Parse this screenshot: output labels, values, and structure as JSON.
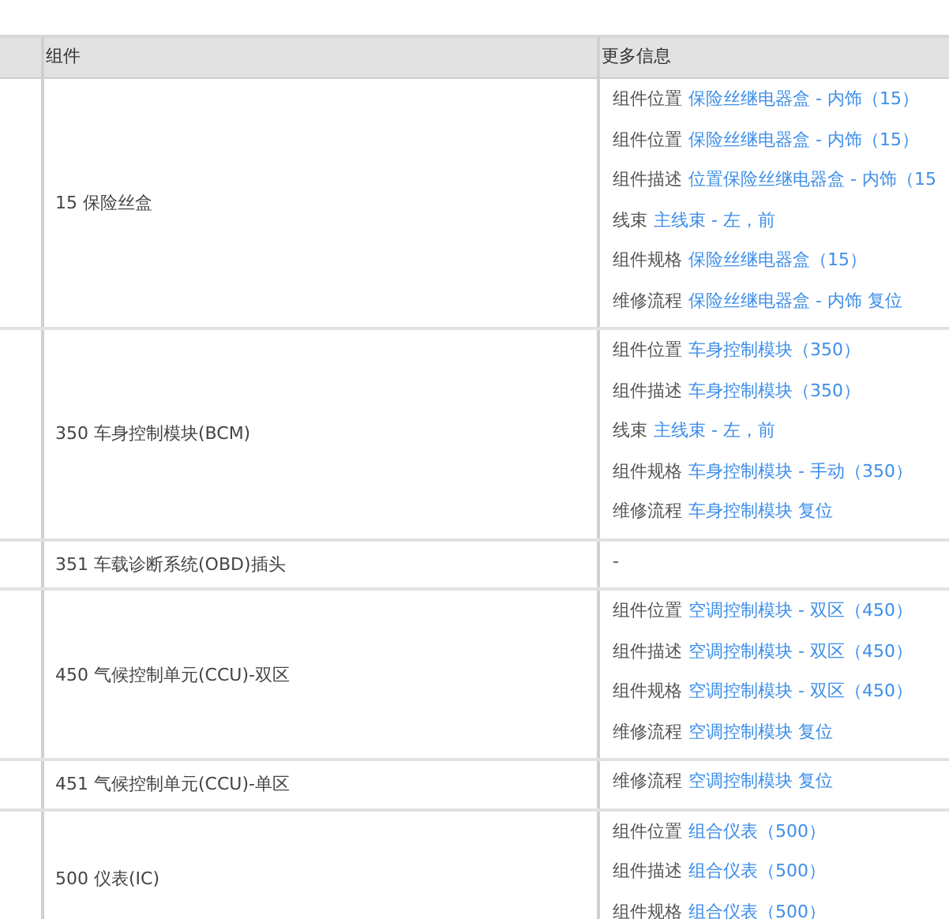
{
  "table": {
    "columns": [
      "组件",
      "更多信息"
    ],
    "rows": [
      {
        "component": "15 保险丝盒",
        "info": [
          {
            "label": "组件位置",
            "link": "保险丝继电器盒 - 内饰（15）"
          },
          {
            "label": "组件位置",
            "link": "保险丝继电器盒 - 内饰（15）"
          },
          {
            "label": "组件描述",
            "link": "位置保险丝继电器盒 - 内饰（15"
          },
          {
            "label": "线束",
            "link": "主线束 - 左，前"
          },
          {
            "label": "组件规格",
            "link": "保险丝继电器盒（15）"
          },
          {
            "label": "维修流程",
            "link": "保险丝继电器盒 - 内饰 复位"
          }
        ]
      },
      {
        "component": "350 车身控制模块(BCM)",
        "info": [
          {
            "label": "组件位置",
            "link": "车身控制模块（350）"
          },
          {
            "label": "组件描述",
            "link": "车身控制模块（350）"
          },
          {
            "label": "线束",
            "link": "主线束 - 左，前"
          },
          {
            "label": "组件规格",
            "link": "车身控制模块 - 手动（350）"
          },
          {
            "label": "维修流程",
            "link": "车身控制模块 复位"
          }
        ]
      },
      {
        "component": "351 车载诊断系统(OBD)插头",
        "info": [
          {
            "label": "-"
          }
        ]
      },
      {
        "component": "450 气候控制单元(CCU)-双区",
        "info": [
          {
            "label": "组件位置",
            "link": "空调控制模块 - 双区（450）"
          },
          {
            "label": "组件描述",
            "link": "空调控制模块 - 双区（450）"
          },
          {
            "label": "组件规格",
            "link": "空调控制模块 - 双区（450）"
          },
          {
            "label": "维修流程",
            "link": "空调控制模块 复位"
          }
        ]
      },
      {
        "component": "451 气候控制单元(CCU)-单区",
        "info": [
          {
            "label": "维修流程",
            "link": "空调控制模块 复位"
          }
        ]
      },
      {
        "component": "500 仪表(IC)",
        "info": [
          {
            "label": "组件位置",
            "link": "组合仪表（500）"
          },
          {
            "label": "组件描述",
            "link": "组合仪表（500）"
          },
          {
            "label": "组件规格",
            "link": "组合仪表（500）"
          }
        ]
      }
    ]
  }
}
